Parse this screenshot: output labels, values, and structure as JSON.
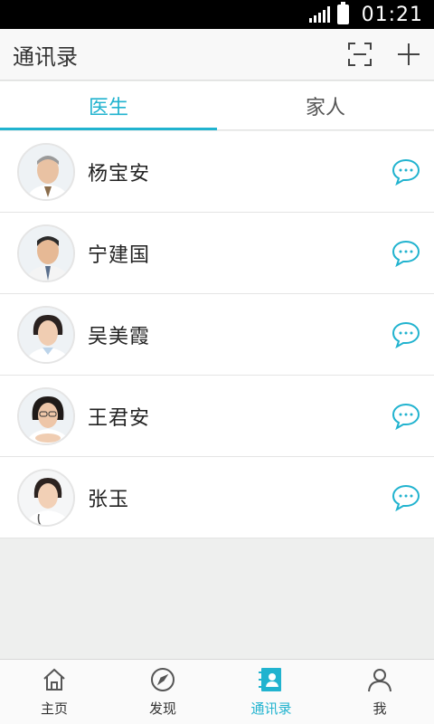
{
  "status_bar": {
    "time": "01:21"
  },
  "header": {
    "title": "通讯录"
  },
  "tabs": [
    {
      "label": "医生",
      "active": true
    },
    {
      "label": "家人",
      "active": false
    }
  ],
  "contacts": [
    {
      "name": "杨宝安"
    },
    {
      "name": "宁建国"
    },
    {
      "name": "吴美霞"
    },
    {
      "name": "王君安"
    },
    {
      "name": "张玉"
    }
  ],
  "bottom_nav": [
    {
      "label": "主页",
      "icon": "home-icon",
      "active": false
    },
    {
      "label": "发现",
      "icon": "compass-icon",
      "active": false
    },
    {
      "label": "通讯录",
      "icon": "contacts-icon",
      "active": true
    },
    {
      "label": "我",
      "icon": "user-icon",
      "active": false
    }
  ],
  "colors": {
    "accent": "#21b3cf",
    "status_bar": "#000000",
    "background": "#eeefee"
  }
}
